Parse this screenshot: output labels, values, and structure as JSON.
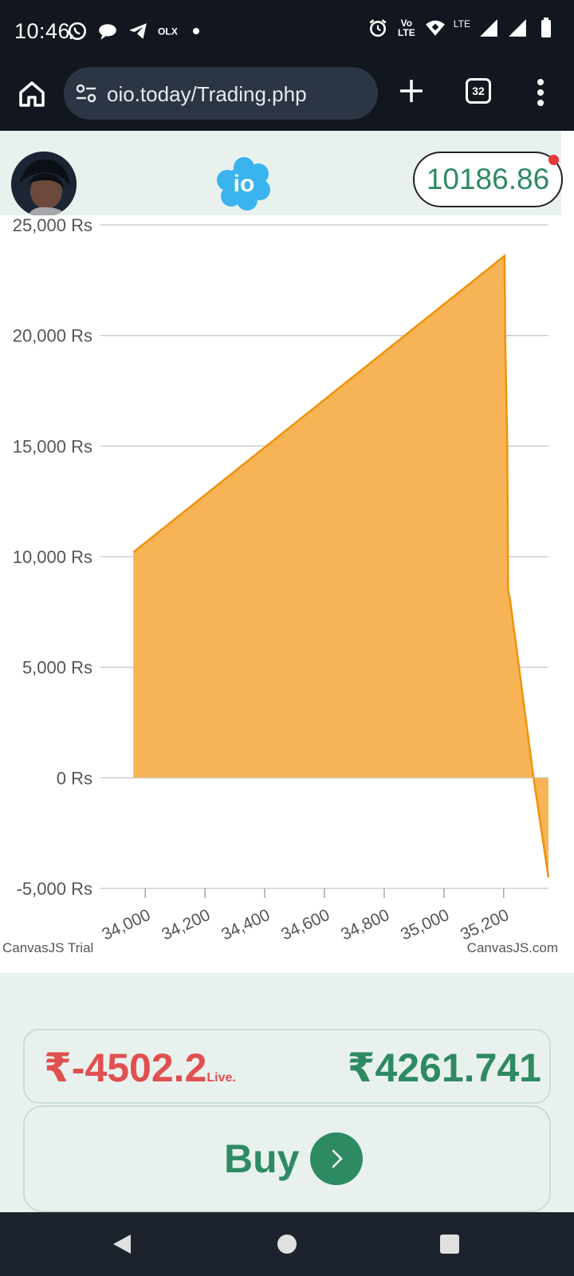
{
  "status_bar": {
    "time": "10:46",
    "network_label": "LTE",
    "volte_label": "Vo LTE",
    "notification_icons": [
      "whatsapp-icon",
      "chat-icon",
      "telegram-icon",
      "olx-icon",
      "dot-icon"
    ],
    "system_icons": [
      "alarm-icon",
      "volte-icon",
      "wifi-icon",
      "signal-icon",
      "signal-icon",
      "battery-icon"
    ]
  },
  "browser": {
    "url": "oio.today/Trading.php",
    "tab_count": "32"
  },
  "header": {
    "balance": "10186.86",
    "logo_text": "io"
  },
  "chart_data": {
    "type": "area",
    "y_axis_labels": [
      "25,000 Rs",
      "20,000 Rs",
      "15,000 Rs",
      "10,000 Rs",
      "5,000 Rs",
      "0 Rs",
      "-5,000 Rs"
    ],
    "x_axis_labels": [
      "34,000",
      "34,200",
      "34,400",
      "34,600",
      "34,800",
      "35,000",
      "35,200"
    ],
    "ylim": [
      -5000,
      25000
    ],
    "xlim": [
      33850,
      35350
    ],
    "x": [
      33960,
      35203,
      35205,
      35212,
      35215,
      35222,
      35300,
      35350
    ],
    "y": [
      10200,
      23600,
      20000,
      15000,
      8500,
      8000,
      0,
      -4500
    ],
    "series_color": "#f5b04d",
    "line_color": "#f0920a",
    "grid": true,
    "watermark_left": "CanvasJS Trial",
    "watermark_right": "CanvasJS.com"
  },
  "trade": {
    "pnl_value": "₹-4502.2",
    "pnl_live": "Live.",
    "current_value": "₹4261.741",
    "buy_label": "Buy"
  },
  "colors": {
    "green": "#2e8a63",
    "red": "#e05050",
    "panel_bg": "#e9f1ee"
  }
}
